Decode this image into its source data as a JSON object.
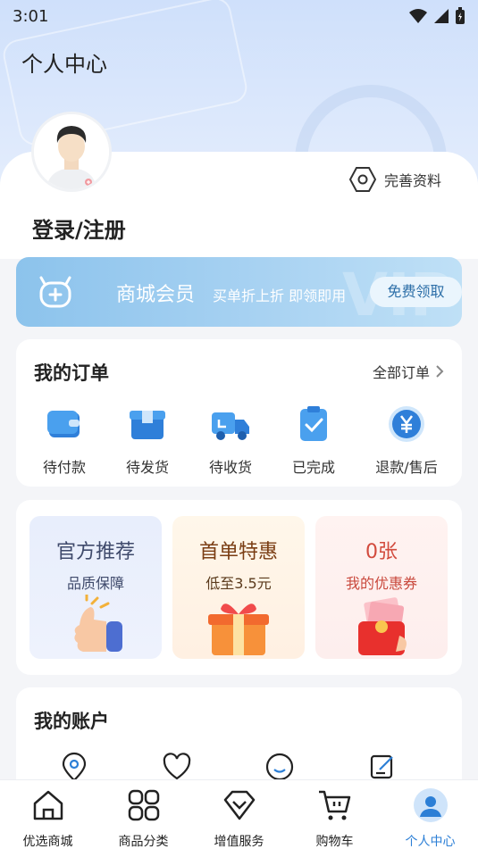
{
  "status_bar": {
    "time": "3:01"
  },
  "header": {
    "title": "个人中心"
  },
  "profile": {
    "edit_label": "完善资料",
    "login_label": "登录/注册"
  },
  "member": {
    "title": "商城会员",
    "subtitle": "买单折上折  即领即用",
    "button": "免费领取",
    "watermark": "VIP"
  },
  "orders": {
    "title": "我的订单",
    "all_label": "全部订单",
    "items": [
      {
        "label": "待付款",
        "icon": "wallet-icon"
      },
      {
        "label": "待发货",
        "icon": "box-icon"
      },
      {
        "label": "待收货",
        "icon": "truck-icon"
      },
      {
        "label": "已完成",
        "icon": "check-clipboard-icon"
      },
      {
        "label": "退款/售后",
        "icon": "yuan-refund-icon"
      }
    ]
  },
  "promos": [
    {
      "title": "官方推荐",
      "subtitle": "品质保障",
      "title_color": "#3f4a6b",
      "sub_color": "#3f4a6b"
    },
    {
      "title": "首单特惠",
      "subtitle": "低至3.5元",
      "title_color": "#7a3d13",
      "sub_color": "#5a3a1c"
    },
    {
      "title": "0张",
      "subtitle": "我的优惠券",
      "title_color": "#d24b3d",
      "sub_color": "#c9493d"
    }
  ],
  "account": {
    "title": "我的账户"
  },
  "tabbar": {
    "items": [
      {
        "label": "优选商城",
        "icon": "home-icon"
      },
      {
        "label": "商品分类",
        "icon": "grid-icon"
      },
      {
        "label": "增值服务",
        "icon": "diamond-icon"
      },
      {
        "label": "购物车",
        "icon": "cart-icon"
      },
      {
        "label": "个人中心",
        "icon": "profile-icon"
      }
    ],
    "active_index": 4
  },
  "colors": {
    "accent": "#2c7fd6",
    "banner": "#8cc3ec"
  }
}
